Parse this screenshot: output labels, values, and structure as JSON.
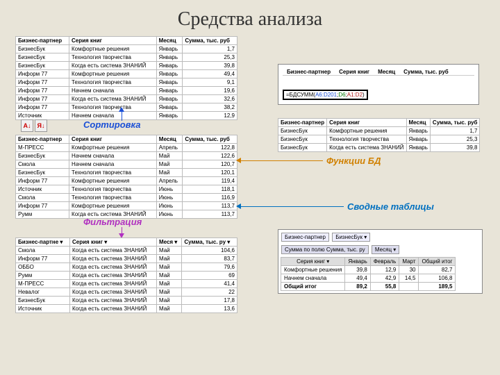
{
  "title": "Средства анализа",
  "labels": {
    "sort": "Сортировка",
    "filter": "Фильтрация",
    "dbfn": "Функции БД",
    "pivot": "Сводные таблицы"
  },
  "headers": {
    "partner": "Бизнес-партнер",
    "partner_s": "Бизнес-партне",
    "series": "Серия книг",
    "month": "Месяц",
    "month_s": "Меся",
    "sum": "Сумма, тыс. руб",
    "sum_s": "Сумма, тыс. ру"
  },
  "table1": {
    "rows": [
      [
        "БизнесБук",
        "Комфортные решения",
        "Январь",
        "1,7"
      ],
      [
        "БизнесБук",
        "Технология творчества",
        "Январь",
        "25,3"
      ],
      [
        "БизнесБук",
        "Когда есть система ЗНАНИЙ",
        "Январь",
        "39,8"
      ],
      [
        "Информ 77",
        "Комфортные решения",
        "Январь",
        "49,4"
      ],
      [
        "Информ 77",
        "Технология творчества",
        "Январь",
        "9,1"
      ],
      [
        "Информ 77",
        "Начнем сначала",
        "Январь",
        "19,6"
      ],
      [
        "Информ 77",
        "Когда есть система ЗНАНИЙ",
        "Январь",
        "32,6"
      ],
      [
        "Информ 77",
        "Технология творчества",
        "Январь",
        "38,2"
      ],
      [
        "Источник",
        "Начнем сначала",
        "Январь",
        "12,9"
      ]
    ]
  },
  "table2": {
    "rows": [
      [
        "М-ПРЕСС",
        "Комфортные решения",
        "Апрель",
        "122,8"
      ],
      [
        "БизнесБук",
        "Начнем сначала",
        "Май",
        "122,6"
      ],
      [
        "Смола",
        "Начнем сначала",
        "Май",
        "120,7"
      ],
      [
        "БизнесБук",
        "Технология творчества",
        "Май",
        "120,1"
      ],
      [
        "Информ 77",
        "Комфортные решения",
        "Апрель",
        "119,4"
      ],
      [
        "Источник",
        "Технология творчества",
        "Июнь",
        "118,1"
      ],
      [
        "Смола",
        "Технология творчества",
        "Июнь",
        "116,9"
      ],
      [
        "Информ 77",
        "Комфортные решения",
        "Июнь",
        "113,7"
      ],
      [
        "Румм",
        "Когда есть система ЗНАНИЙ",
        "Июнь",
        "113,7"
      ]
    ]
  },
  "table3": {
    "rows": [
      [
        "Смола",
        "Когда есть система ЗНАНИЙ",
        "Май",
        "104,6"
      ],
      [
        "Информ 77",
        "Когда есть система ЗНАНИЙ",
        "Май",
        "83,7"
      ],
      [
        "ОББО",
        "Когда есть система ЗНАНИЙ",
        "Май",
        "79,6"
      ],
      [
        "Румм",
        "Когда есть система ЗНАНИЙ",
        "Май",
        "69"
      ],
      [
        "М-ПРЕСС",
        "Когда есть система ЗНАНИЙ",
        "Май",
        "41,4"
      ],
      [
        "Невалог",
        "Когда есть система ЗНАНИЙ",
        "Май",
        "22"
      ],
      [
        "БизнесБук",
        "Когда есть система ЗНАНИЙ",
        "Май",
        "17,8"
      ],
      [
        "Источник",
        "Когда есть система ЗНАНИЙ",
        "Май",
        "13,6"
      ]
    ]
  },
  "formula": {
    "text_fn": "=БДСУММ(",
    "r1": "A6:D201",
    "r2": "D6",
    "r3": "A1:D2",
    "close": ")"
  },
  "table4": {
    "rows": [
      [
        "БизнесБук",
        "Комфортные решения",
        "Январь",
        "1,7"
      ],
      [
        "БизнесБук",
        "Технология творчества",
        "Январь",
        "25,3"
      ],
      [
        "БизнесБук",
        "Когда есть система ЗНАНИЙ",
        "Январь",
        "39,8"
      ]
    ]
  },
  "pivot": {
    "drop1": "Бизнес-партнер",
    "drop2": "БизнесБук",
    "sum_label": "Сумма по полю Сумма, тыс. ру",
    "month_label": "Месяц",
    "series_label": "Серия книг",
    "months": [
      "Январь",
      "Февраль",
      "Март"
    ],
    "total_col": "Общий итог",
    "total_row": "Общий итог",
    "rows": [
      [
        "Комфортные решения",
        "39,8",
        "12,9",
        "30",
        "82,7"
      ],
      [
        "Начнем сначала",
        "49,4",
        "42,9",
        "14,5",
        "106,8"
      ],
      [
        "",
        "89,2",
        "55,8",
        "",
        "189,5"
      ]
    ]
  }
}
